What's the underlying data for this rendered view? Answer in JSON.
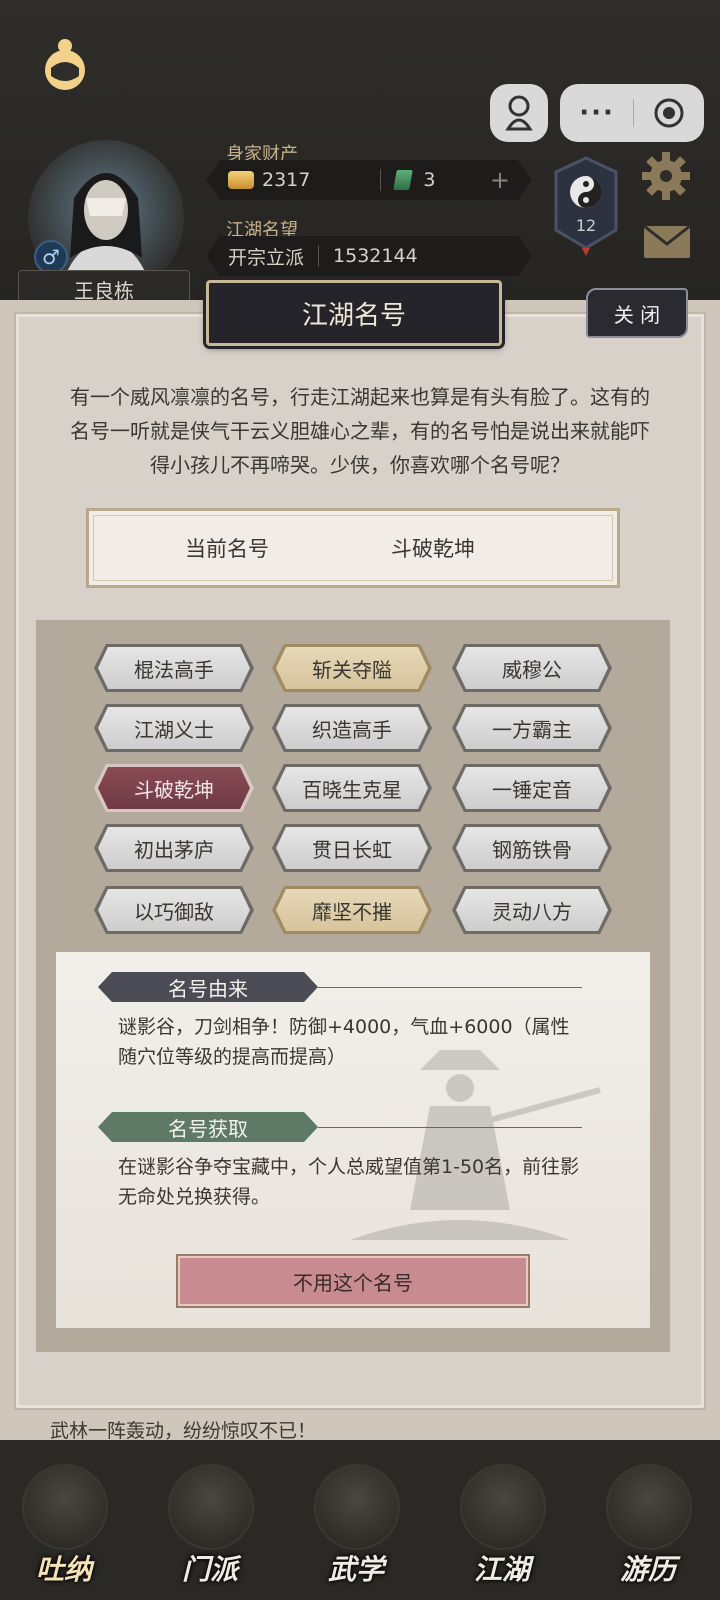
{
  "header": {
    "player_name": "王良栋",
    "gender_symbol": "♂",
    "wealth_label": "身家财产",
    "gold": "2317",
    "jade": "3",
    "reputation_label": "江湖名望",
    "rank_title": "开宗立派",
    "reputation_value": "1532144",
    "level": "12",
    "capsule_dots": "···"
  },
  "modal": {
    "title": "江湖名号",
    "close_label": "关 闭",
    "intro": "有一个威风凛凛的名号，行走江湖起来也算是有头有脸了。这有的名号一听就是侠气干云义胆雄心之辈，有的名号怕是说出来就能吓得小孩儿不再啼哭。少侠，你喜欢哪个名号呢？",
    "current_label": "当前名号",
    "current_value": "斗破乾坤",
    "titles": [
      {
        "label": "棍法高手",
        "style": "normal"
      },
      {
        "label": "斩关夺隘",
        "style": "gold"
      },
      {
        "label": "威穆公",
        "style": "normal"
      },
      {
        "label": "江湖义士",
        "style": "normal"
      },
      {
        "label": "织造高手",
        "style": "normal"
      },
      {
        "label": "一方霸主",
        "style": "normal"
      },
      {
        "label": "斗破乾坤",
        "style": "selected"
      },
      {
        "label": "百晓生克星",
        "style": "normal"
      },
      {
        "label": "一锤定音",
        "style": "normal"
      },
      {
        "label": "初出茅庐",
        "style": "normal"
      },
      {
        "label": "贯日长虹",
        "style": "normal"
      },
      {
        "label": "钢筋铁骨",
        "style": "normal"
      },
      {
        "label": "以巧御敌",
        "style": "normal"
      },
      {
        "label": "靡坚不摧",
        "style": "gold"
      },
      {
        "label": "灵动八方",
        "style": "normal"
      }
    ],
    "origin_tag": "名号由来",
    "origin_text": "谜影谷，刀剑相争！防御+4000，气血+6000（属性随穴位等级的提高而提高）",
    "obtain_tag": "名号获取",
    "obtain_text": "在谜影谷争夺宝藏中，个人总威望值第1-50名，前往影无命处兑换获得。",
    "unuse_label": "不用这个名号"
  },
  "background_news": "武林一阵轰动，纷纷惊叹不已！",
  "bottom_nav": [
    {
      "label": "吐纳"
    },
    {
      "label": "门派"
    },
    {
      "label": "武学"
    },
    {
      "label": "江湖"
    },
    {
      "label": "游历"
    }
  ],
  "colors": {
    "accent_gold": "#c8b893",
    "selected_title": "#7a414b",
    "origin_tag": "#4a4b55",
    "obtain_tag": "#5e7a66",
    "unuse_button": "#c88b90"
  }
}
